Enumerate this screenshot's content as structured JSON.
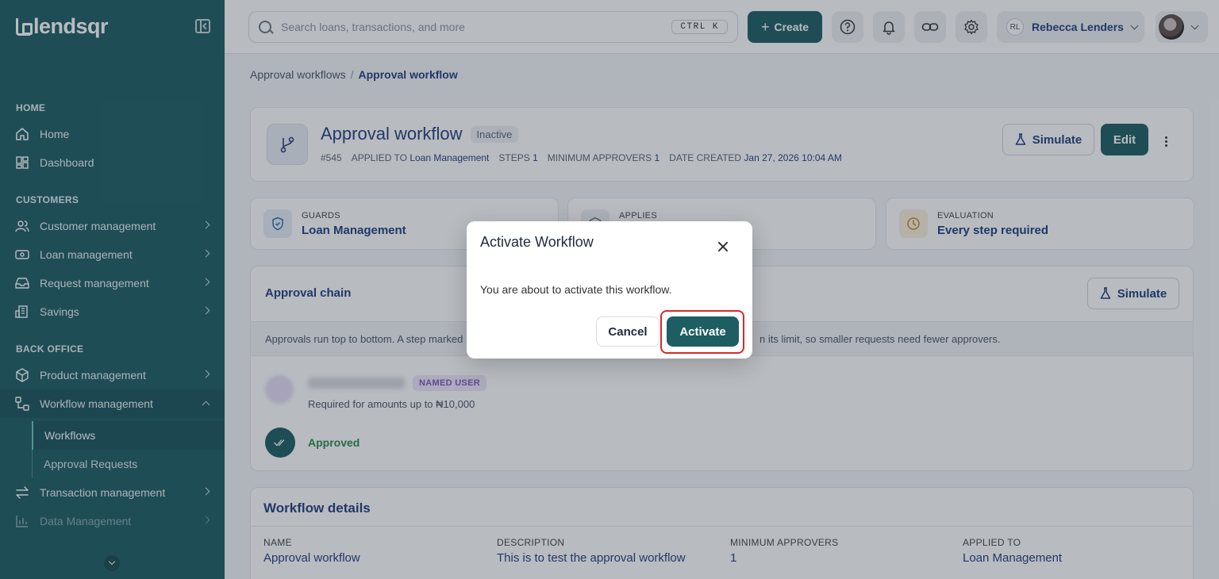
{
  "brand": {
    "name": "lendsqr"
  },
  "sidebar": {
    "sections": [
      {
        "label": "HOME"
      },
      {
        "label": "CUSTOMERS"
      },
      {
        "label": "BACK OFFICE"
      }
    ],
    "items": [
      {
        "label": "Home",
        "icon": "home-icon"
      },
      {
        "label": "Dashboard",
        "icon": "dashboard-icon"
      },
      {
        "label": "Customer management",
        "icon": "users-icon"
      },
      {
        "label": "Loan management",
        "icon": "loan-icon"
      },
      {
        "label": "Request management",
        "icon": "inbox-icon"
      },
      {
        "label": "Savings",
        "icon": "bank-icon"
      },
      {
        "label": "Product management",
        "icon": "box-icon"
      },
      {
        "label": "Workflow management",
        "icon": "workflow-icon"
      },
      {
        "label": "Transaction management",
        "icon": "transfer-icon"
      },
      {
        "label": "Data Management",
        "icon": "chart-icon"
      }
    ],
    "subitems": [
      {
        "label": "Workflows"
      },
      {
        "label": "Approval Requests"
      }
    ]
  },
  "topbar": {
    "search_placeholder": "Search loans, transactions, and more",
    "shortcut": "CTRL K",
    "create_label": "Create",
    "user_initials": "RL",
    "user_name": "Rebecca Lenders"
  },
  "breadcrumb": {
    "parent": "Approval workflows",
    "separator": "/",
    "current": "Approval workflow"
  },
  "workflow": {
    "title": "Approval workflow",
    "status": "Inactive",
    "id": "#545",
    "applied_to_label": "APPLIED TO",
    "applied_to": "Loan Management",
    "steps_label": "STEPS",
    "steps": "1",
    "min_approvers_label": "MINIMUM APPROVERS",
    "min_approvers": "1",
    "date_created_label": "DATE CREATED",
    "date_created": "Jan 27, 2026 10:04 AM",
    "simulate_label": "Simulate",
    "edit_label": "Edit"
  },
  "info_cards": [
    {
      "label": "GUARDS",
      "value": "Loan Management",
      "color": "#2f6fb0"
    },
    {
      "label": "APPLIES",
      "value": "",
      "color": "#6b7685"
    },
    {
      "label": "EVALUATION",
      "value": "Every step required",
      "color": "#c58a2a"
    }
  ],
  "chain": {
    "title": "Approval chain",
    "simulate_label": "Simulate",
    "note_left": "Approvals run top to bottom. A step marked",
    "note_right": "n its limit, so smaller requests need fewer approvers.",
    "named_badge": "NAMED USER",
    "required_text": "Required for amounts up to ₦10,000",
    "approved_label": "Approved"
  },
  "details": {
    "title": "Workflow details",
    "columns": [
      {
        "key": "NAME",
        "value": "Approval workflow"
      },
      {
        "key": "DESCRIPTION",
        "value": "This is to test the approval workflow"
      },
      {
        "key": "MINIMUM APPROVERS",
        "value": "1"
      },
      {
        "key": "APPLIED TO",
        "value": "Loan Management"
      }
    ]
  },
  "modal": {
    "title": "Activate Workflow",
    "body": "You are about to activate this workflow.",
    "cancel_label": "Cancel",
    "activate_label": "Activate",
    "highlight_color": "#d62a2a"
  },
  "colors": {
    "brand": "#1d5e63",
    "text": "#213f7d"
  }
}
